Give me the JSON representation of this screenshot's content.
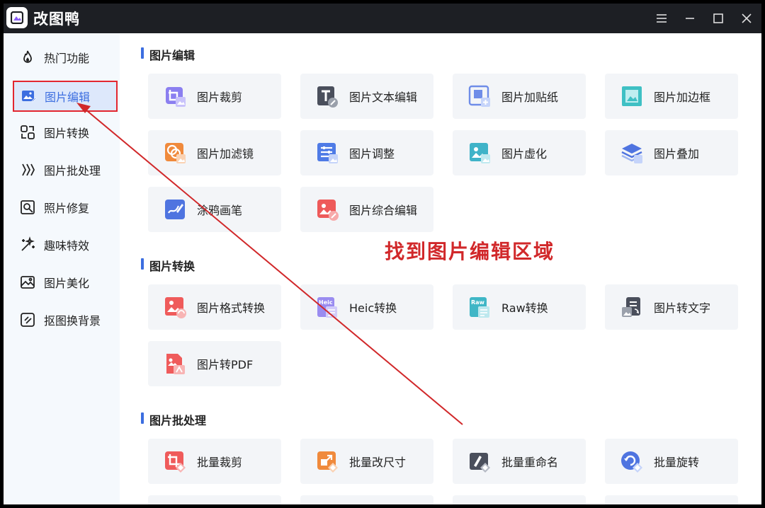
{
  "app": {
    "title": "改图鸭"
  },
  "sidebar": {
    "items": [
      {
        "label": "热门功能",
        "icon": "fire-icon"
      },
      {
        "label": "图片编辑",
        "icon": "image-edit-icon",
        "active": true
      },
      {
        "label": "图片转换",
        "icon": "convert-icon"
      },
      {
        "label": "图片批处理",
        "icon": "batch-icon"
      },
      {
        "label": "照片修复",
        "icon": "photo-repair-icon"
      },
      {
        "label": "趣味特效",
        "icon": "magic-wand-icon"
      },
      {
        "label": "图片美化",
        "icon": "beautify-icon"
      },
      {
        "label": "抠图换背景",
        "icon": "cutout-icon"
      }
    ]
  },
  "sections": [
    {
      "title": "图片编辑",
      "cards": [
        {
          "label": "图片裁剪",
          "icon": "crop-icon",
          "color": "#8b7ff0"
        },
        {
          "label": "图片文本编辑",
          "icon": "text-edit-icon",
          "color": "#4a4f5c"
        },
        {
          "label": "图片加贴纸",
          "icon": "sticker-icon",
          "color": "#6f8de8"
        },
        {
          "label": "图片加边框",
          "icon": "border-icon",
          "color": "#3fc0c4"
        },
        {
          "label": "图片加滤镜",
          "icon": "filter-icon",
          "color": "#f08a3c"
        },
        {
          "label": "图片调整",
          "icon": "adjust-icon",
          "color": "#4f7be6"
        },
        {
          "label": "图片虚化",
          "icon": "blur-icon",
          "color": "#3fb3c8"
        },
        {
          "label": "图片叠加",
          "icon": "layers-icon",
          "color": "#4f74e0"
        },
        {
          "label": "涂鸦画笔",
          "icon": "brush-icon",
          "color": "#4f74e0"
        },
        {
          "label": "图片综合编辑",
          "icon": "comprehensive-edit-icon",
          "color": "#ee5a5a"
        }
      ]
    },
    {
      "title": "图片转换",
      "cards": [
        {
          "label": "图片格式转换",
          "icon": "format-convert-icon",
          "color": "#ef5b5b"
        },
        {
          "label": "Heic转换",
          "icon": "heic-icon",
          "color": "#9a8cf0",
          "badge": "Heic"
        },
        {
          "label": "Raw转换",
          "icon": "raw-icon",
          "color": "#3fb6c6",
          "badge": "Raw"
        },
        {
          "label": "图片转文字",
          "icon": "image-to-text-icon",
          "color": "#4a4f5c"
        },
        {
          "label": "图片转PDF",
          "icon": "image-to-pdf-icon",
          "color": "#ef5b5b"
        }
      ]
    },
    {
      "title": "图片批处理",
      "cards": [
        {
          "label": "批量裁剪",
          "icon": "batch-crop-icon",
          "color": "#ef5b5b"
        },
        {
          "label": "批量改尺寸",
          "icon": "batch-resize-icon",
          "color": "#f08a3c"
        },
        {
          "label": "批量重命名",
          "icon": "batch-rename-icon",
          "color": "#4a4f5c"
        },
        {
          "label": "批量旋转",
          "icon": "batch-rotate-icon",
          "color": "#4f74e0"
        }
      ]
    }
  ],
  "annotation": {
    "text": "找到图片编辑区域",
    "color": "#d1282a"
  }
}
